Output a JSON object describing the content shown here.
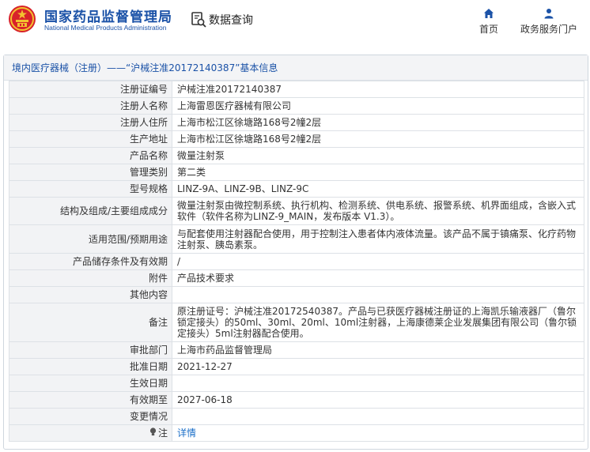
{
  "header": {
    "site_name_cn": "国家药品监督管理局",
    "site_name_en": "National Medical Products Administration",
    "query_label": "数据查询",
    "nav": [
      {
        "label": "首页",
        "icon": "home-icon"
      },
      {
        "label": "政务服务门户",
        "icon": "person-icon"
      }
    ]
  },
  "panel": {
    "title": "境内医疗器械（注册）——“沪械注准20172140387”基本信息"
  },
  "colors": {
    "brand_blue": "#1b52a7",
    "link_blue": "#1b6fc8",
    "label_bg": "#f2f3f5"
  },
  "rows": [
    {
      "label": "注册证编号",
      "value": "沪械注准20172140387"
    },
    {
      "label": "注册人名称",
      "value": "上海雷恩医疗器械有限公司"
    },
    {
      "label": "注册人住所",
      "value": "上海市松江区徐塘路168号2幢2层"
    },
    {
      "label": "生产地址",
      "value": "上海市松江区徐塘路168号2幢2层"
    },
    {
      "label": "产品名称",
      "value": "微量注射泵"
    },
    {
      "label": "管理类别",
      "value": "第二类"
    },
    {
      "label": "型号规格",
      "value": "LINZ-9A、LINZ-9B、LINZ-9C"
    },
    {
      "label": "结构及组成/主要组成成分",
      "value": "微量注射泵由微控制系统、执行机构、检测系统、供电系统、报警系统、机界面组成，含嵌入式软件（软件名称为LINZ-9_MAIN，发布版本 V1.3）。"
    },
    {
      "label": "适用范围/预期用途",
      "value": "与配套使用注射器配合使用，用于控制注入患者体内液体流量。该产品不属于镇痛泵、化疗药物注射泵、胰岛素泵。"
    },
    {
      "label": "产品储存条件及有效期",
      "value": "/"
    },
    {
      "label": "附件",
      "value": "产品技术要求"
    },
    {
      "label": "其他内容",
      "value": ""
    },
    {
      "label": "备注",
      "value": "原注册证号：沪械注准20172540387。产品与已获医疗器械注册证的上海凯乐输液器厂（鲁尔锁定接头）的50ml、30ml、20ml、10ml注射器，上海康德莱企业发展集团有限公司（鲁尔锁定接头）5ml注射器配合使用。"
    },
    {
      "label": "审批部门",
      "value": "上海市药品监督管理局"
    },
    {
      "label": "批准日期",
      "value": "2021-12-27"
    },
    {
      "label": "生效日期",
      "value": ""
    },
    {
      "label": "有效期至",
      "value": "2027-06-18"
    },
    {
      "label": "变更情况",
      "value": ""
    }
  ],
  "note": {
    "label": "注",
    "icon": "lightbulb-icon",
    "link": "详情"
  }
}
